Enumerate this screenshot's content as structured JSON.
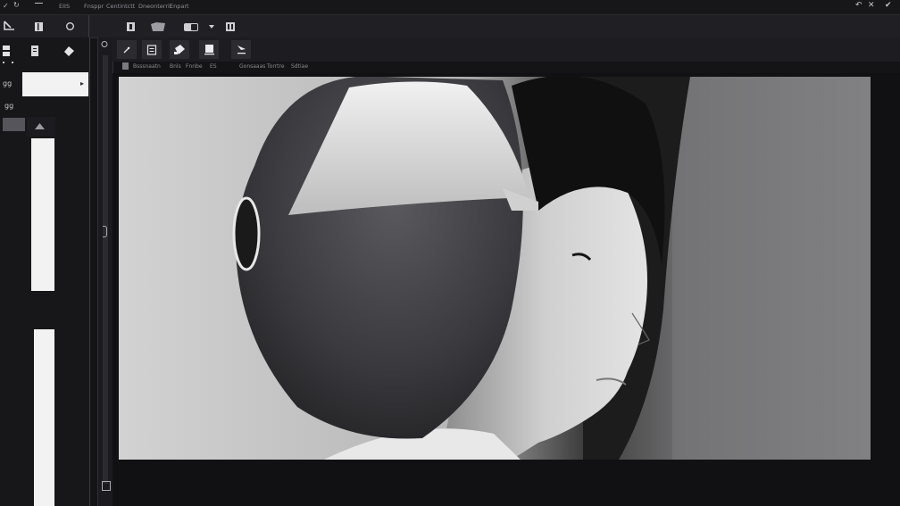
{
  "menubar": {
    "items": [
      "EIIS",
      "Fnsppr",
      "Centintctt",
      "Dneonterrii",
      "Enpart"
    ]
  },
  "infobar": {
    "items": [
      "Bsssnaatn",
      "Bnls",
      "Fnnbe",
      "ES",
      "Gonsaaas",
      "Torrtre",
      "Sdtiae"
    ]
  },
  "leftpanel": {
    "field_arrow": "▸",
    "tag1": "gg",
    "tag2": "gg"
  },
  "colors": {
    "background": "#141417",
    "panel": "#17171a",
    "toolbar": "#202024",
    "field": "#f2f2f2"
  }
}
